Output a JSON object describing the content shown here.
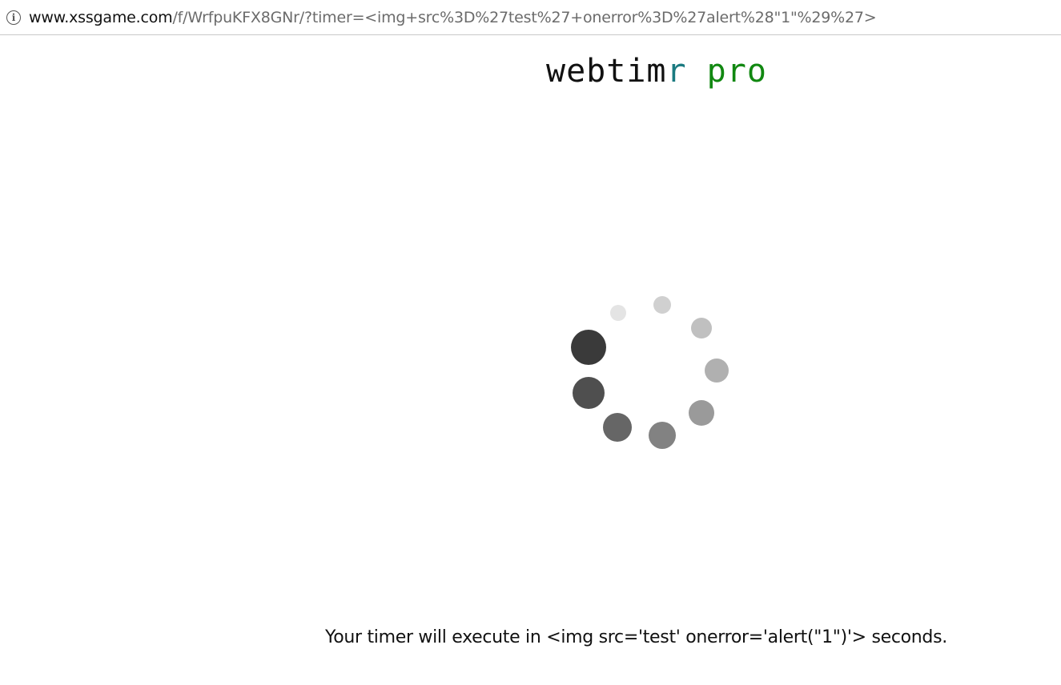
{
  "browser": {
    "url_host": "www.xssgame.com",
    "url_path": "/f/WrfpuKFX8GNr/?timer=<img+src%3D%27test%27+onerror%3D%27alert%28\"1\"%29%27>",
    "info_icon": "info-circle-icon"
  },
  "page": {
    "title_part_a": "webtim",
    "title_part_b": "r",
    "title_part_c": " pro",
    "colors": {
      "title_dark": "#111111",
      "title_teal": "#1a7a80",
      "title_green": "#118811"
    }
  },
  "spinner": {
    "icon": "loading-spinner-icon",
    "dot_count": 9
  },
  "message": {
    "text": "Your timer will execute in <img src='test' onerror='alert(\"1\")'> seconds."
  }
}
